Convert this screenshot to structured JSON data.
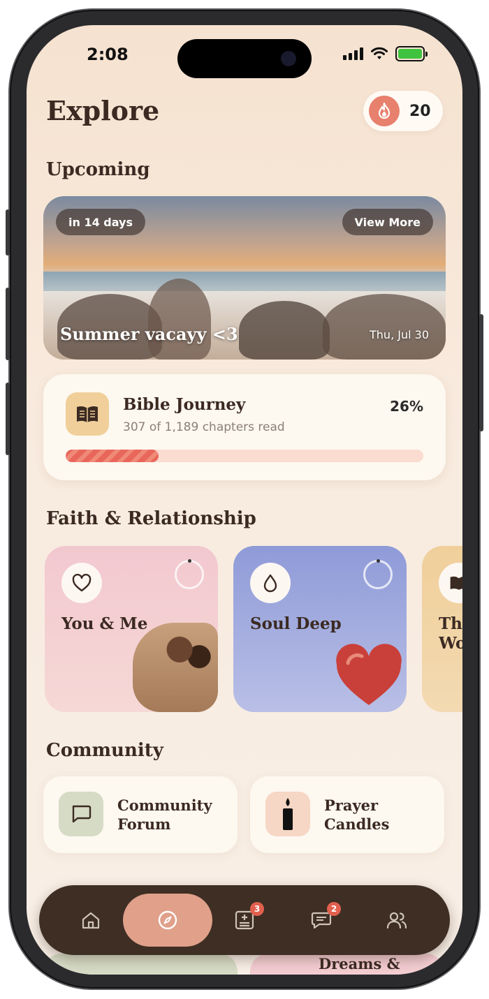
{
  "status_bar": {
    "time": "2:08"
  },
  "header": {
    "title": "Explore",
    "streak_count": "20"
  },
  "upcoming": {
    "section_title": "Upcoming",
    "event": {
      "countdown": "in 14 days",
      "view_more": "View More",
      "name": "Summer vacayy <3",
      "date": "Thu, Jul 30"
    }
  },
  "bible_journey": {
    "title": "Bible Journey",
    "subtitle": "307 of 1,189 chapters read",
    "percent_label": "26%",
    "progress": 0.26
  },
  "faith": {
    "section_title": "Faith & Relationship",
    "cards": [
      {
        "title": "You & Me",
        "icon": "heart-icon",
        "color": "#f4cdd2"
      },
      {
        "title": "Soul Deep",
        "icon": "drop-icon",
        "color": "#a3acdc"
      },
      {
        "title": "Thr Wo",
        "icon": "book-icon",
        "color": "#f0cf9a"
      }
    ]
  },
  "community": {
    "section_title": "Community",
    "items": [
      {
        "label": "Community Forum",
        "icon": "chat-icon",
        "color": "#d6dbc6"
      },
      {
        "label": "Prayer Candles",
        "icon": "candle-icon",
        "color": "#f6d6c4"
      }
    ]
  },
  "peek": {
    "right_label": "Dreams &"
  },
  "tabbar": {
    "tabs": [
      {
        "name": "home",
        "icon": "home-icon"
      },
      {
        "name": "explore",
        "icon": "compass-icon",
        "active": true
      },
      {
        "name": "journal",
        "icon": "journal-icon",
        "badge": "3"
      },
      {
        "name": "messages",
        "icon": "message-icon",
        "badge": "2"
      },
      {
        "name": "friends",
        "icon": "people-icon"
      }
    ]
  },
  "colors": {
    "accent": "#e8806e",
    "tabbar": "#3e2e24",
    "active_tab": "#e0a08a",
    "progress": "#e8675a"
  }
}
